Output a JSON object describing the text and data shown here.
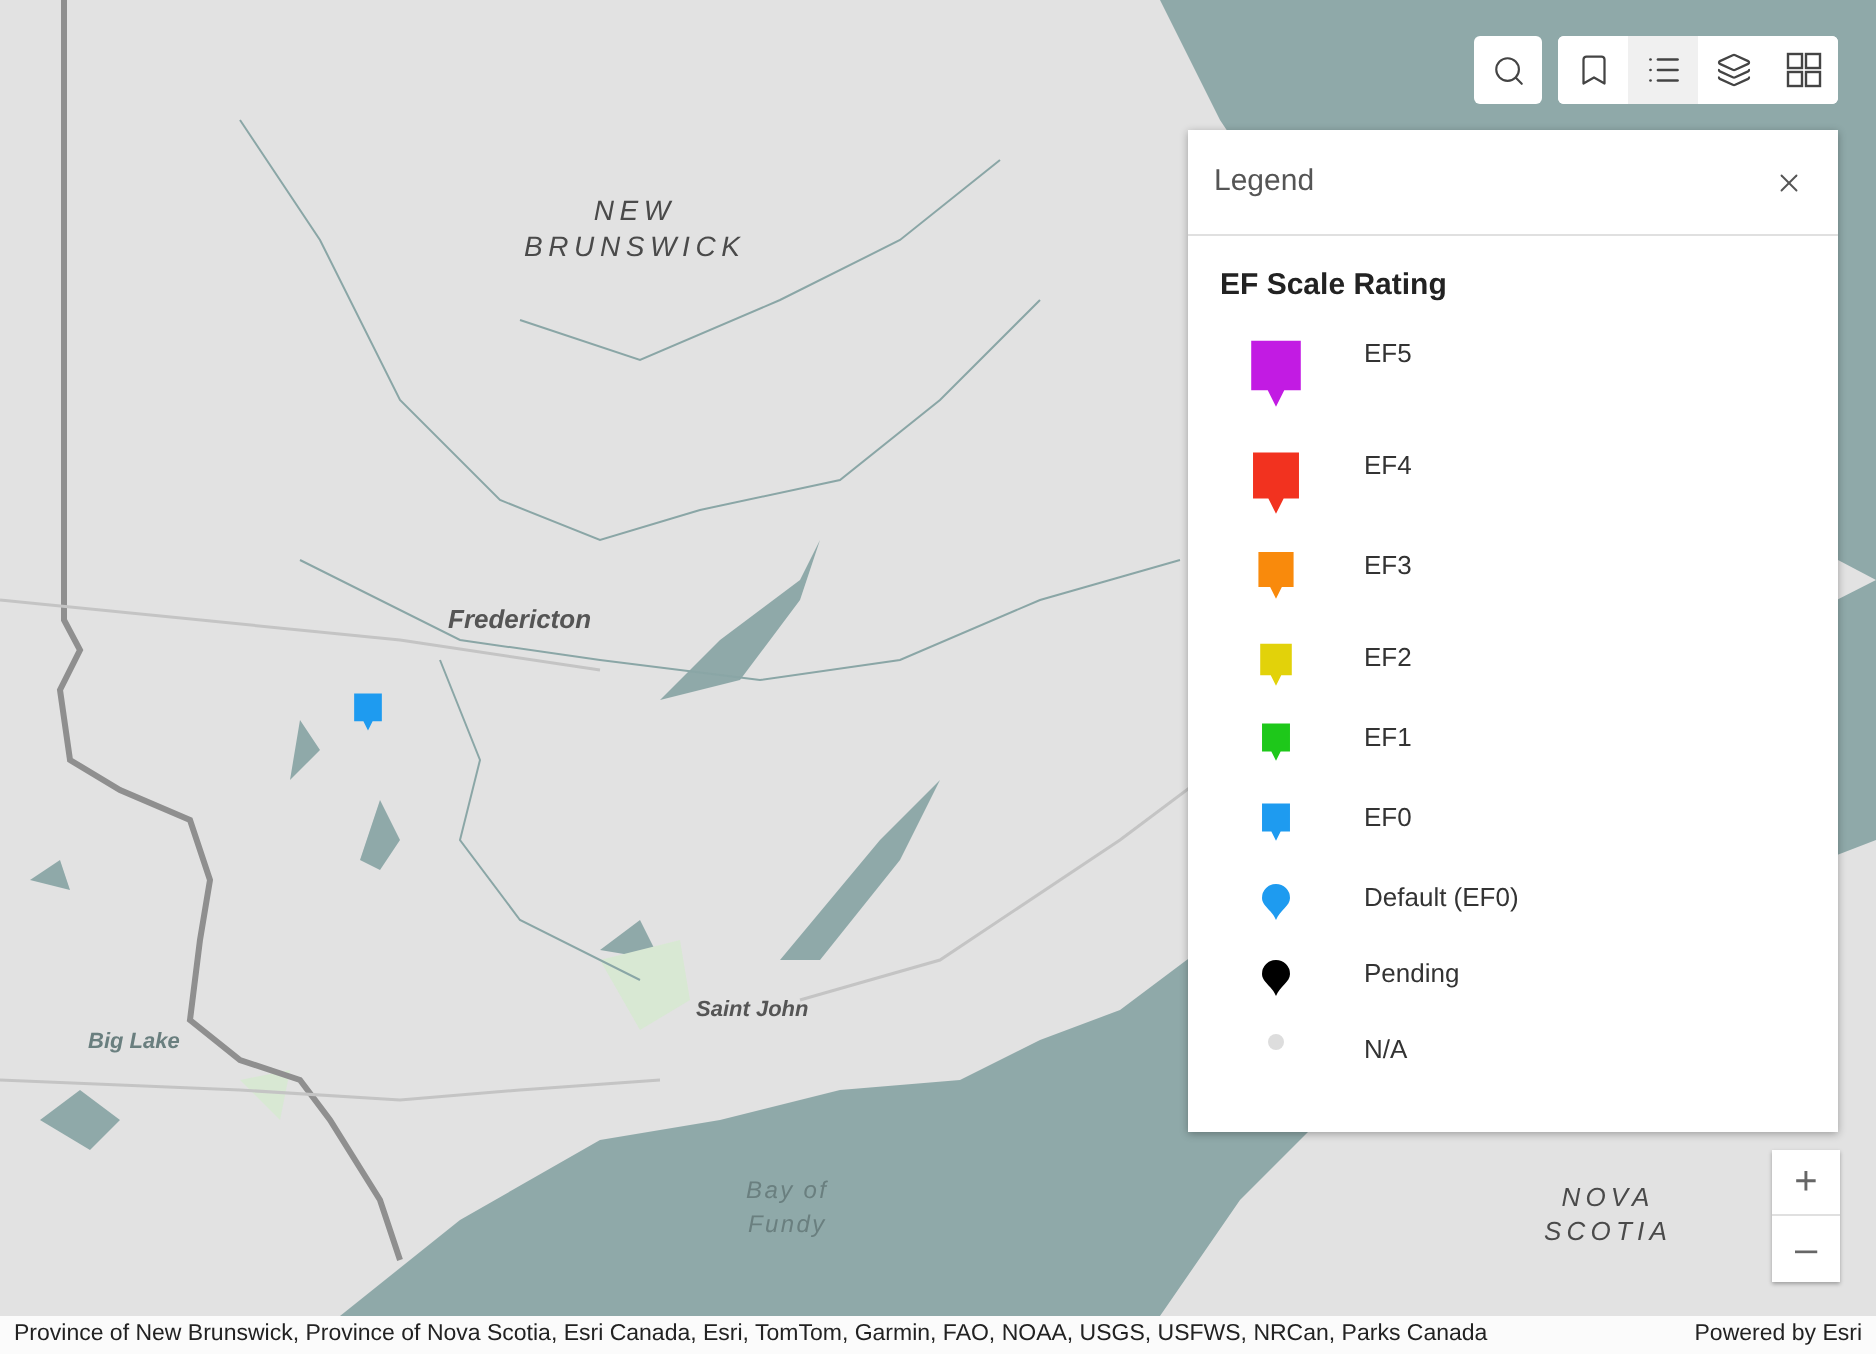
{
  "map": {
    "labels": [
      {
        "text": "NEW\nBRUNSWICK",
        "kind": "region"
      },
      {
        "text": "Fredericton",
        "kind": "city"
      },
      {
        "text": "Saint John",
        "kind": "city"
      },
      {
        "text": "Big Lake",
        "kind": "water"
      },
      {
        "text": "Bay of\nFundy",
        "kind": "water"
      },
      {
        "text": "NOVA\nSCOTIA",
        "kind": "region"
      }
    ],
    "markers": [
      {
        "color": "#1e9bf0"
      }
    ]
  },
  "toolbar": {
    "buttons": [
      {
        "kind": "search",
        "selected": false
      },
      {
        "kind": "bookmarks",
        "selected": false
      },
      {
        "kind": "legend",
        "selected": true
      },
      {
        "kind": "layers",
        "selected": false
      },
      {
        "kind": "basemaps",
        "selected": false
      }
    ]
  },
  "legend": {
    "title": "Legend",
    "layer_title": "EF Scale Rating",
    "items": [
      {
        "label": "EF5",
        "kind": "square-pin",
        "color": "#c21be3"
      },
      {
        "label": "EF4",
        "kind": "square-pin",
        "color": "#f2321f"
      },
      {
        "label": "EF3",
        "kind": "square-pin",
        "color": "#f98a0c"
      },
      {
        "label": "EF2",
        "kind": "square-pin",
        "color": "#e2d20a"
      },
      {
        "label": "EF1",
        "kind": "square-pin",
        "color": "#1ec81a"
      },
      {
        "label": "EF0",
        "kind": "square-pin",
        "color": "#1e9bf0"
      },
      {
        "label": "Default (EF0)",
        "kind": "round-pin",
        "color": "#1e9bf0"
      },
      {
        "label": "Pending",
        "kind": "round-pin",
        "color": "#000000"
      },
      {
        "label": "N/A",
        "kind": "dot",
        "color": "#dddddd"
      }
    ]
  },
  "zoom": {
    "in": "+",
    "out": "–"
  },
  "attribution": {
    "sources": "Province of New Brunswick, Province of Nova Scotia, Esri Canada, Esri, TomTom, Garmin, FAO, NOAA, USGS, USFWS, NRCan, Parks Canada",
    "powered_by": "Powered by Esri"
  }
}
